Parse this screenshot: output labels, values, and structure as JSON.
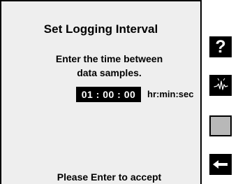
{
  "dialog": {
    "title": "Set Logging Interval",
    "prompt_line1": "Enter the time between",
    "prompt_line2": "data samples.",
    "interval_value": "01 : 00 : 00",
    "interval_unit": "hr:min:sec",
    "footer": "Please Enter to accept"
  },
  "side_buttons": {
    "help_glyph": "?",
    "icons": [
      "question-mark-icon",
      "probe-sensor-icon",
      "blank-square-icon",
      "arrow-left-icon"
    ]
  },
  "colors": {
    "panel_background": "#eeeeee",
    "button_dark": "#000000",
    "button_light": "#b8b8b8",
    "value_text": "#ffffff"
  }
}
